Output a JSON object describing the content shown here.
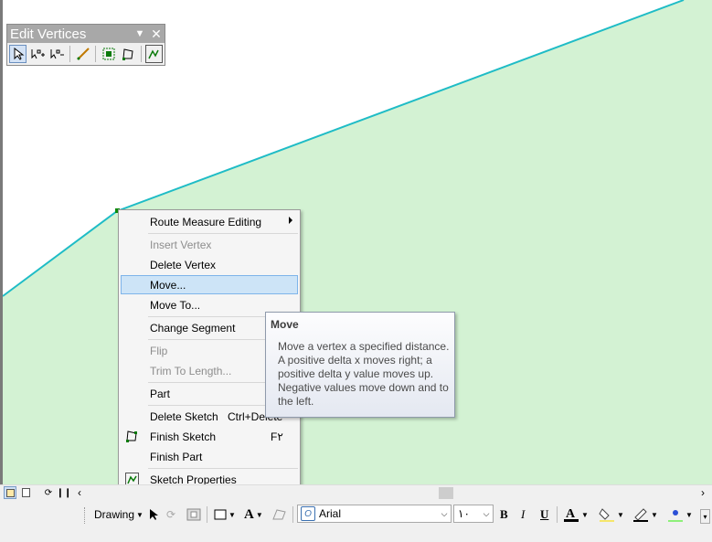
{
  "edit_vertices_toolbar": {
    "title": "Edit Vertices",
    "tools": [
      {
        "icon": "modify-sketch-vertices-icon",
        "selected": true
      },
      {
        "icon": "add-vertex-icon"
      },
      {
        "icon": "delete-vertex-icon"
      },
      {
        "icon": "continue-feature-icon"
      },
      {
        "icon": "sketch-properties-grid-icon"
      },
      {
        "icon": "finish-sketch-icon"
      },
      {
        "icon": "sketch-properties-icon"
      }
    ]
  },
  "context_menu": {
    "items": {
      "route_measure": "Route Measure Editing",
      "insert_vertex": "Insert Vertex",
      "delete_vertex": "Delete Vertex",
      "move": "Move...",
      "move_to": "Move To...",
      "change_segment": "Change Segment",
      "flip": "Flip",
      "trim": "Trim To Length...",
      "part": "Part",
      "delete_sketch": "Delete Sketch",
      "delete_sketch_shortcut": "Ctrl+Delete",
      "finish_sketch": "Finish Sketch",
      "finish_sketch_shortcut": "F۲",
      "finish_part": "Finish Part",
      "sketch_properties": "Sketch Properties"
    }
  },
  "tooltip": {
    "title": "Move",
    "body": "Move a vertex a specified distance. A positive delta x moves right; a positive delta y value moves up. Negative values move down and to the left."
  },
  "drawing_toolbar": {
    "drawing_label": "Drawing",
    "font_name": "Arial",
    "font_size": "۱۰",
    "bold": "B",
    "italic": "I",
    "underline": "U",
    "font_color_letter": "A"
  },
  "colors": {
    "map_fill": "#d3f2d3",
    "line": "#1fbcc6",
    "highlight": "#cde4f7"
  }
}
